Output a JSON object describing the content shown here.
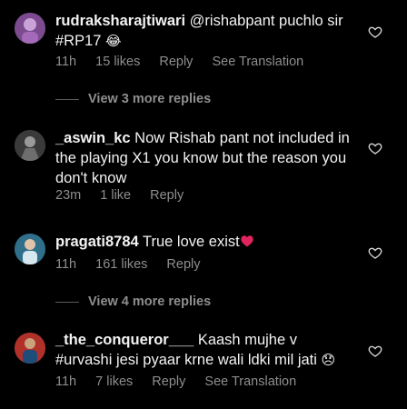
{
  "comments": [
    {
      "username": "rudraksharajtiwari",
      "text": "@rishabpant puchlo sir #RP17",
      "emoji": "😂",
      "time": "11h",
      "likes": "15 likes",
      "reply": "Reply",
      "translate": "See Translation",
      "view_more": "View 3 more replies"
    },
    {
      "username": "_aswin_kc",
      "text": "Now Rishab pant not included in the playing X1 you know but the reason you don't know",
      "emoji": "",
      "time": "23m",
      "likes": "1 like",
      "reply": "Reply"
    },
    {
      "username": "pragati8784",
      "text": "True love exist",
      "emoji": "❤️",
      "time": "11h",
      "likes": "161 likes",
      "reply": "Reply",
      "view_more": "View 4 more replies"
    },
    {
      "username": "_the_conqueror___",
      "text": "Kaash mujhe v #urvashi jesi pyaar krne wali ldki mil jati",
      "emoji": "😞",
      "time": "11h",
      "likes": "7 likes",
      "reply": "Reply",
      "translate": "See Translation"
    }
  ],
  "icons": {
    "like": "heart-outline-icon"
  },
  "colors": {
    "background": "#000000",
    "text": "#f2f2f2",
    "muted": "#8e8e8e",
    "heart_emoji": "#e0245e"
  }
}
